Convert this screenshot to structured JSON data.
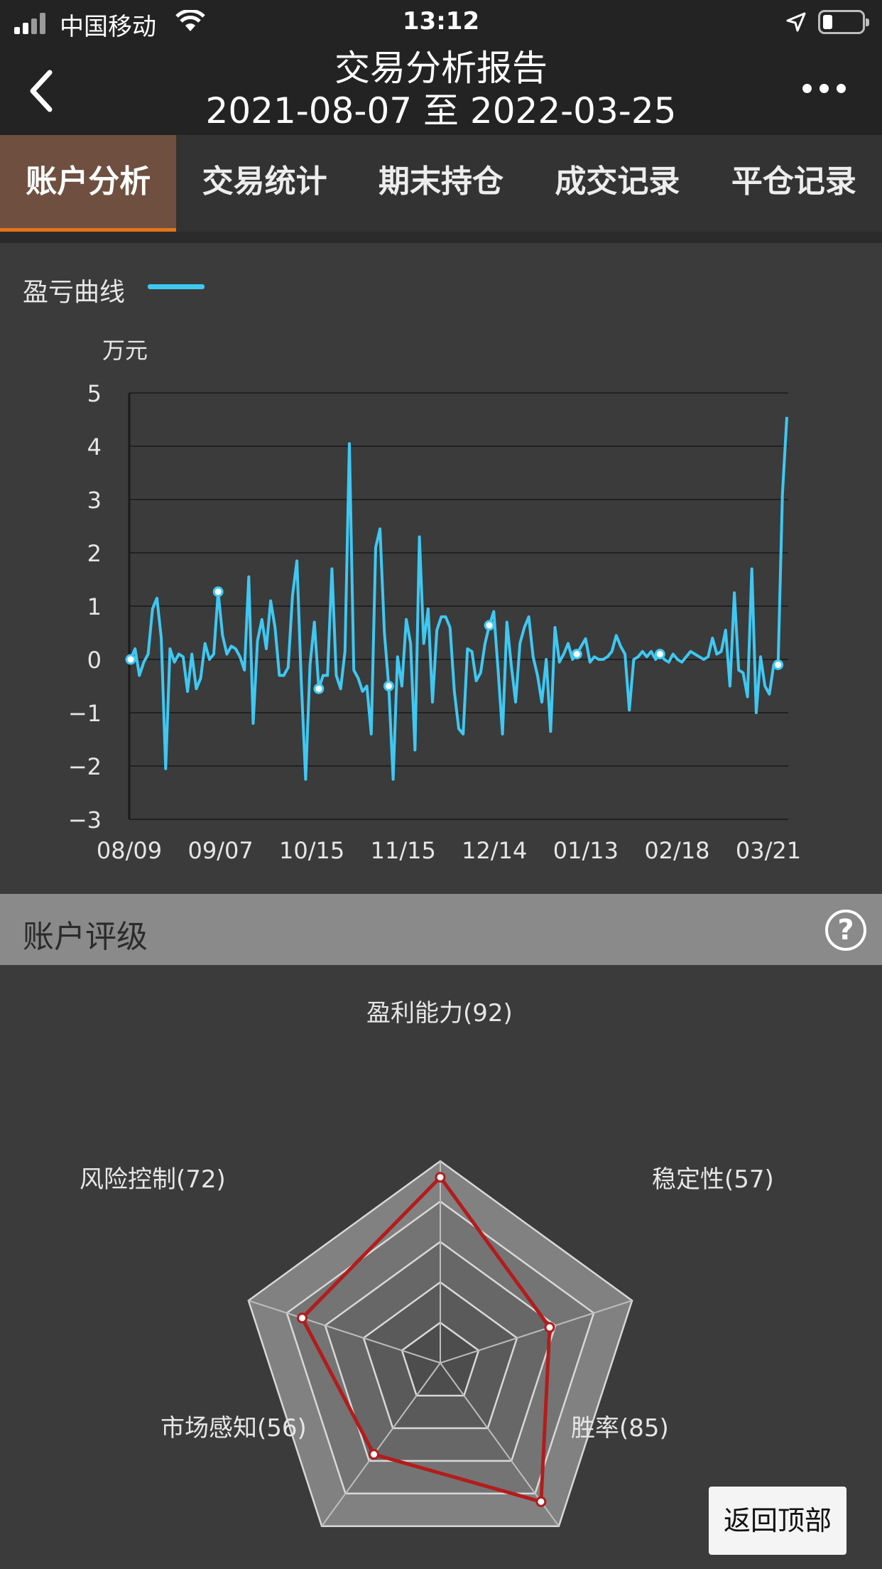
{
  "status_bar": {
    "carrier": "中国移动",
    "time": "13:12"
  },
  "nav": {
    "title": "交易分析报告",
    "subtitle": "2021-08-07 至 2022-03-25"
  },
  "tabs": [
    {
      "label": "账户分析",
      "active": true
    },
    {
      "label": "交易统计",
      "active": false
    },
    {
      "label": "期末持仓",
      "active": false
    },
    {
      "label": "成交记录",
      "active": false
    },
    {
      "label": "平仓记录",
      "active": false
    }
  ],
  "chart": {
    "legend": "盈亏曲线",
    "unit": "万元"
  },
  "chart_data": {
    "type": "line",
    "color": "#3ec8f2",
    "ylim": [
      -3,
      5
    ],
    "yticks": [
      "5",
      "4",
      "3",
      "2",
      "1",
      "0",
      "−1",
      "−2",
      "−3"
    ],
    "ytick_values": [
      5,
      4,
      3,
      2,
      1,
      0,
      -1,
      -2,
      -3
    ],
    "xticks": [
      "08/09",
      "09/07",
      "10/15",
      "11/15",
      "12/14",
      "01/13",
      "02/18",
      "03/21"
    ],
    "grid": true,
    "series": [
      {
        "values": [
          0.0,
          0.2,
          -0.3,
          -0.05,
          0.1,
          0.95,
          1.15,
          0.4,
          -2.05,
          0.2,
          -0.05,
          0.1,
          0.05,
          -0.6,
          0.1,
          -0.55,
          -0.35,
          0.3,
          0.0,
          0.1,
          1.27,
          0.45,
          0.1,
          0.25,
          0.2,
          0.05,
          -0.2,
          1.55,
          -1.2,
          0.35,
          0.75,
          0.2,
          1.1,
          0.6,
          -0.3,
          -0.3,
          -0.15,
          1.2,
          1.85,
          -0.4,
          -2.25,
          -0.1,
          0.7,
          -0.55,
          -0.3,
          -0.3,
          1.7,
          -0.3,
          -0.55,
          0.15,
          4.05,
          -0.2,
          -0.35,
          -0.6,
          -0.5,
          -1.4,
          2.1,
          2.45,
          0.5,
          -0.5,
          -2.25,
          0.05,
          -0.5,
          0.75,
          0.3,
          -1.7,
          2.3,
          0.3,
          0.95,
          -0.8,
          0.55,
          0.8,
          0.8,
          0.6,
          -0.6,
          -1.3,
          -1.4,
          0.2,
          0.15,
          -0.4,
          -0.25,
          0.3,
          0.64,
          0.9,
          -0.2,
          -1.4,
          0.7,
          -0.1,
          -0.8,
          0.3,
          0.6,
          0.8,
          0.05,
          -0.3,
          -0.8,
          0.0,
          -1.35,
          0.6,
          -0.05,
          0.1,
          0.3,
          0.0,
          0.1,
          0.25,
          0.39,
          -0.05,
          0.05,
          0.0,
          0.0,
          0.05,
          0.15,
          0.45,
          0.25,
          0.1,
          -0.95,
          0.0,
          0.05,
          0.15,
          0.05,
          0.15,
          0.0,
          0.1,
          0.0,
          -0.05,
          0.1,
          0.0,
          -0.05,
          0.05,
          0.15,
          0.1,
          0.05,
          0.0,
          0.05,
          0.4,
          0.1,
          0.15,
          0.55,
          -0.5,
          1.25,
          -0.2,
          -0.25,
          -0.7,
          1.7,
          -1.0,
          0.05,
          -0.5,
          -0.65,
          -0.1,
          -0.1,
          3.1,
          4.55
        ],
        "markers": [
          0,
          20,
          43,
          59,
          82,
          102,
          121,
          148
        ]
      }
    ]
  },
  "rating": {
    "title": "账户评级",
    "help_icon": "question-circle-icon",
    "axes": [
      {
        "name": "盈利能力(92)",
        "value": 92
      },
      {
        "name": "稳定性(57)",
        "value": 57
      },
      {
        "name": "胜率(85)",
        "value": 85
      },
      {
        "name": "市场感知(56)",
        "value": 56
      },
      {
        "name": "风险控制(72)",
        "value": 72
      }
    ],
    "max": 100,
    "line_color": "#b31c1c"
  },
  "back_to_top": "返回顶部"
}
